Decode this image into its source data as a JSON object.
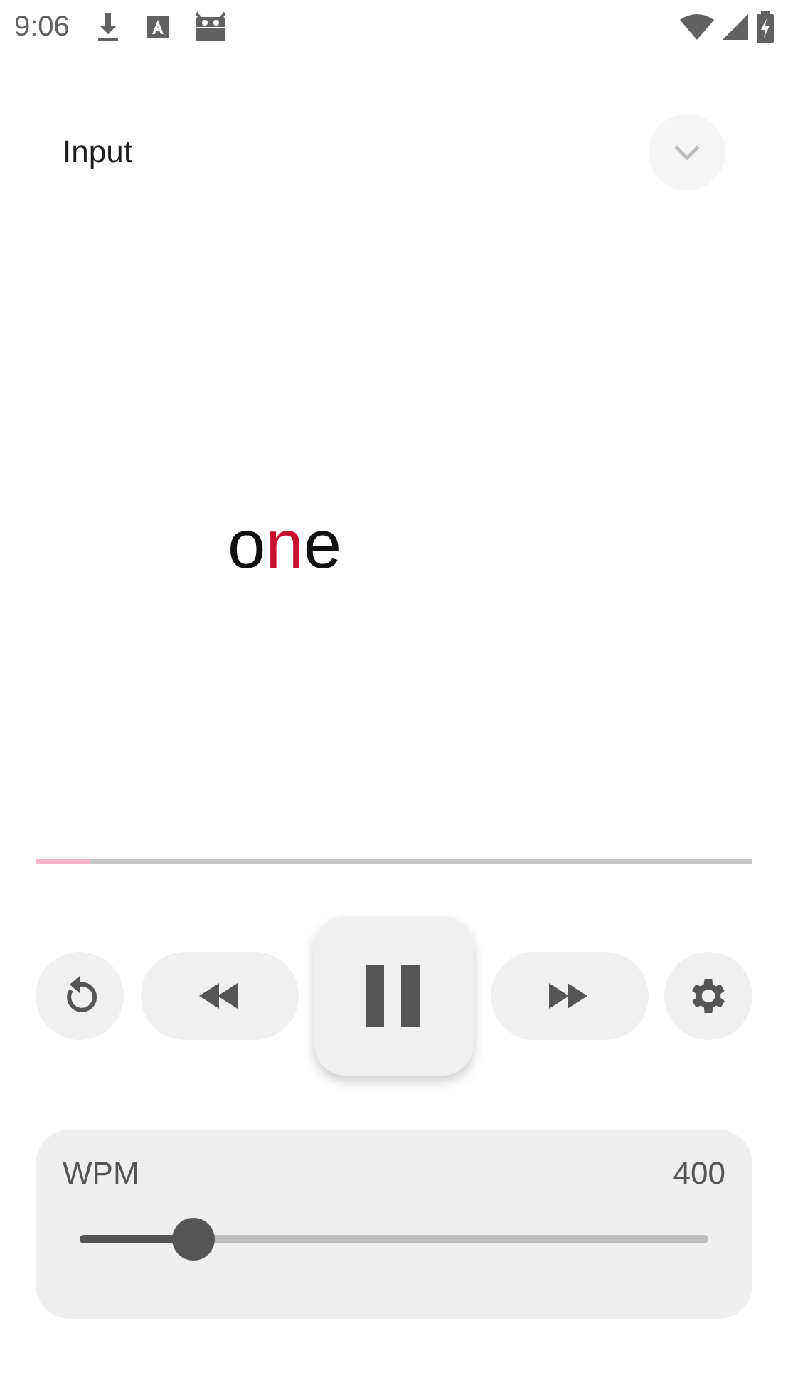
{
  "status_bar": {
    "time": "9:06"
  },
  "header": {
    "title": "Input",
    "expanded": false
  },
  "word": {
    "letters": [
      {
        "text": "o",
        "highlighted": false
      },
      {
        "text": "n",
        "highlighted": true
      },
      {
        "text": "e",
        "highlighted": false
      }
    ]
  },
  "progress": {
    "level": 0.075
  },
  "controls": [
    {
      "kind": "restart"
    },
    {
      "kind": "rewind"
    },
    {
      "kind": "pause"
    },
    {
      "kind": "forward"
    },
    {
      "kind": "settings"
    }
  ],
  "wpm": {
    "label": "WPM",
    "reading": "400",
    "level": 0.18
  }
}
